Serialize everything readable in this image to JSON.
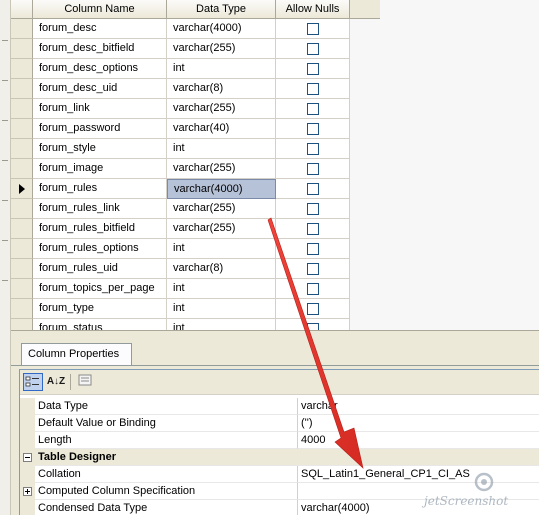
{
  "grid": {
    "columns": [
      "Column Name",
      "Data Type",
      "Allow Nulls"
    ],
    "rows": [
      {
        "name": "forum_desc",
        "type": "varchar(4000)",
        "nulls": false
      },
      {
        "name": "forum_desc_bitfield",
        "type": "varchar(255)",
        "nulls": false
      },
      {
        "name": "forum_desc_options",
        "type": "int",
        "nulls": false
      },
      {
        "name": "forum_desc_uid",
        "type": "varchar(8)",
        "nulls": false
      },
      {
        "name": "forum_link",
        "type": "varchar(255)",
        "nulls": false
      },
      {
        "name": "forum_password",
        "type": "varchar(40)",
        "nulls": false
      },
      {
        "name": "forum_style",
        "type": "int",
        "nulls": false
      },
      {
        "name": "forum_image",
        "type": "varchar(255)",
        "nulls": false
      },
      {
        "name": "forum_rules",
        "type": "varchar(4000)",
        "nulls": false,
        "current": true
      },
      {
        "name": "forum_rules_link",
        "type": "varchar(255)",
        "nulls": false
      },
      {
        "name": "forum_rules_bitfield",
        "type": "varchar(255)",
        "nulls": false
      },
      {
        "name": "forum_rules_options",
        "type": "int",
        "nulls": false
      },
      {
        "name": "forum_rules_uid",
        "type": "varchar(8)",
        "nulls": false
      },
      {
        "name": "forum_topics_per_page",
        "type": "int",
        "nulls": false
      },
      {
        "name": "forum_type",
        "type": "int",
        "nulls": false
      },
      {
        "name": "forum_status",
        "type": "int",
        "nulls": false
      }
    ]
  },
  "column_properties": {
    "tab_label": "Column Properties",
    "toolbar": {
      "alpha_label": "A↓Z"
    },
    "rows": [
      {
        "name": "Data Type",
        "value": "varchar"
      },
      {
        "name": "Default Value or Binding",
        "value": "('')"
      },
      {
        "name": "Length",
        "value": "4000"
      },
      {
        "category": "Table Designer"
      },
      {
        "name": "Collation",
        "value": "SQL_Latin1_General_CP1_CI_AS"
      },
      {
        "name": "Computed Column Specification",
        "value": "",
        "expandable": true
      },
      {
        "name": "Condensed Data Type",
        "value": "varchar(4000)"
      }
    ]
  },
  "watermark": "jetScreenshot",
  "colors": {
    "selected_cell": "#b6c2d8",
    "arrow": "#e8312a"
  }
}
